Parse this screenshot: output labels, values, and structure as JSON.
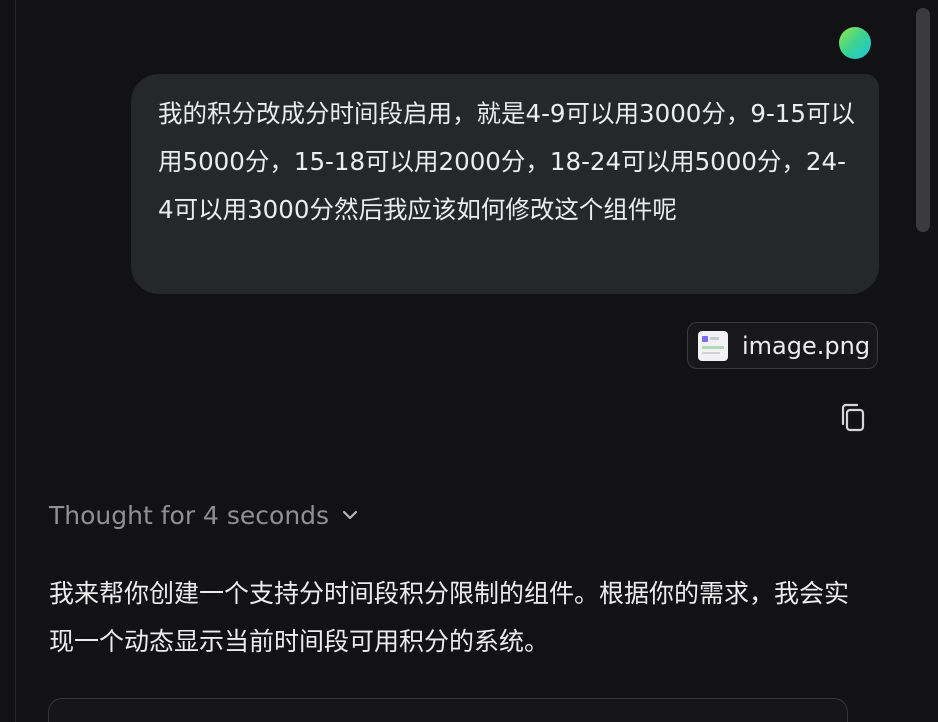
{
  "user_message": {
    "text": "我的积分改成分时间段启用，就是4-9可以用3000分，9-15可以用5000分，15-18可以用2000分，18-24可以用5000分，24-4可以用3000分然后我应该如何修改这个组件呢"
  },
  "attachment": {
    "filename": "image.png",
    "icon": "image-thumbnail-icon"
  },
  "actions": {
    "copy_icon": "copy-icon"
  },
  "thought": {
    "label": "Thought for 4 seconds",
    "icon": "chevron-down-icon"
  },
  "assistant_message": {
    "text": "我来帮你创建一个支持分时间段积分限制的组件。根据你的需求，我会实现一个动态显示当前时间段可用积分的系统。"
  }
}
